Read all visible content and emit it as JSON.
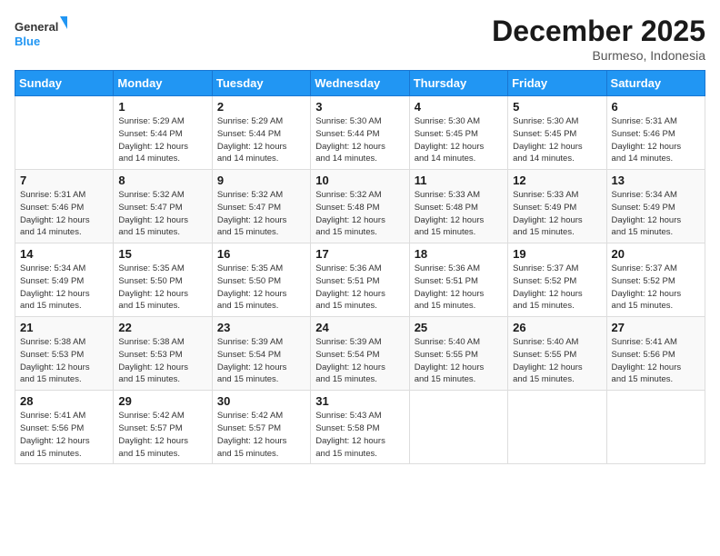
{
  "header": {
    "logo_line1": "General",
    "logo_line2": "Blue",
    "month": "December 2025",
    "location": "Burmeso, Indonesia"
  },
  "days_of_week": [
    "Sunday",
    "Monday",
    "Tuesday",
    "Wednesday",
    "Thursday",
    "Friday",
    "Saturday"
  ],
  "weeks": [
    [
      {
        "day": "",
        "info": ""
      },
      {
        "day": "1",
        "info": "Sunrise: 5:29 AM\nSunset: 5:44 PM\nDaylight: 12 hours\nand 14 minutes."
      },
      {
        "day": "2",
        "info": "Sunrise: 5:29 AM\nSunset: 5:44 PM\nDaylight: 12 hours\nand 14 minutes."
      },
      {
        "day": "3",
        "info": "Sunrise: 5:30 AM\nSunset: 5:44 PM\nDaylight: 12 hours\nand 14 minutes."
      },
      {
        "day": "4",
        "info": "Sunrise: 5:30 AM\nSunset: 5:45 PM\nDaylight: 12 hours\nand 14 minutes."
      },
      {
        "day": "5",
        "info": "Sunrise: 5:30 AM\nSunset: 5:45 PM\nDaylight: 12 hours\nand 14 minutes."
      },
      {
        "day": "6",
        "info": "Sunrise: 5:31 AM\nSunset: 5:46 PM\nDaylight: 12 hours\nand 14 minutes."
      }
    ],
    [
      {
        "day": "7",
        "info": "Sunrise: 5:31 AM\nSunset: 5:46 PM\nDaylight: 12 hours\nand 14 minutes."
      },
      {
        "day": "8",
        "info": "Sunrise: 5:32 AM\nSunset: 5:47 PM\nDaylight: 12 hours\nand 15 minutes."
      },
      {
        "day": "9",
        "info": "Sunrise: 5:32 AM\nSunset: 5:47 PM\nDaylight: 12 hours\nand 15 minutes."
      },
      {
        "day": "10",
        "info": "Sunrise: 5:32 AM\nSunset: 5:48 PM\nDaylight: 12 hours\nand 15 minutes."
      },
      {
        "day": "11",
        "info": "Sunrise: 5:33 AM\nSunset: 5:48 PM\nDaylight: 12 hours\nand 15 minutes."
      },
      {
        "day": "12",
        "info": "Sunrise: 5:33 AM\nSunset: 5:49 PM\nDaylight: 12 hours\nand 15 minutes."
      },
      {
        "day": "13",
        "info": "Sunrise: 5:34 AM\nSunset: 5:49 PM\nDaylight: 12 hours\nand 15 minutes."
      }
    ],
    [
      {
        "day": "14",
        "info": "Sunrise: 5:34 AM\nSunset: 5:49 PM\nDaylight: 12 hours\nand 15 minutes."
      },
      {
        "day": "15",
        "info": "Sunrise: 5:35 AM\nSunset: 5:50 PM\nDaylight: 12 hours\nand 15 minutes."
      },
      {
        "day": "16",
        "info": "Sunrise: 5:35 AM\nSunset: 5:50 PM\nDaylight: 12 hours\nand 15 minutes."
      },
      {
        "day": "17",
        "info": "Sunrise: 5:36 AM\nSunset: 5:51 PM\nDaylight: 12 hours\nand 15 minutes."
      },
      {
        "day": "18",
        "info": "Sunrise: 5:36 AM\nSunset: 5:51 PM\nDaylight: 12 hours\nand 15 minutes."
      },
      {
        "day": "19",
        "info": "Sunrise: 5:37 AM\nSunset: 5:52 PM\nDaylight: 12 hours\nand 15 minutes."
      },
      {
        "day": "20",
        "info": "Sunrise: 5:37 AM\nSunset: 5:52 PM\nDaylight: 12 hours\nand 15 minutes."
      }
    ],
    [
      {
        "day": "21",
        "info": "Sunrise: 5:38 AM\nSunset: 5:53 PM\nDaylight: 12 hours\nand 15 minutes."
      },
      {
        "day": "22",
        "info": "Sunrise: 5:38 AM\nSunset: 5:53 PM\nDaylight: 12 hours\nand 15 minutes."
      },
      {
        "day": "23",
        "info": "Sunrise: 5:39 AM\nSunset: 5:54 PM\nDaylight: 12 hours\nand 15 minutes."
      },
      {
        "day": "24",
        "info": "Sunrise: 5:39 AM\nSunset: 5:54 PM\nDaylight: 12 hours\nand 15 minutes."
      },
      {
        "day": "25",
        "info": "Sunrise: 5:40 AM\nSunset: 5:55 PM\nDaylight: 12 hours\nand 15 minutes."
      },
      {
        "day": "26",
        "info": "Sunrise: 5:40 AM\nSunset: 5:55 PM\nDaylight: 12 hours\nand 15 minutes."
      },
      {
        "day": "27",
        "info": "Sunrise: 5:41 AM\nSunset: 5:56 PM\nDaylight: 12 hours\nand 15 minutes."
      }
    ],
    [
      {
        "day": "28",
        "info": "Sunrise: 5:41 AM\nSunset: 5:56 PM\nDaylight: 12 hours\nand 15 minutes."
      },
      {
        "day": "29",
        "info": "Sunrise: 5:42 AM\nSunset: 5:57 PM\nDaylight: 12 hours\nand 15 minutes."
      },
      {
        "day": "30",
        "info": "Sunrise: 5:42 AM\nSunset: 5:57 PM\nDaylight: 12 hours\nand 15 minutes."
      },
      {
        "day": "31",
        "info": "Sunrise: 5:43 AM\nSunset: 5:58 PM\nDaylight: 12 hours\nand 15 minutes."
      },
      {
        "day": "",
        "info": ""
      },
      {
        "day": "",
        "info": ""
      },
      {
        "day": "",
        "info": ""
      }
    ]
  ]
}
